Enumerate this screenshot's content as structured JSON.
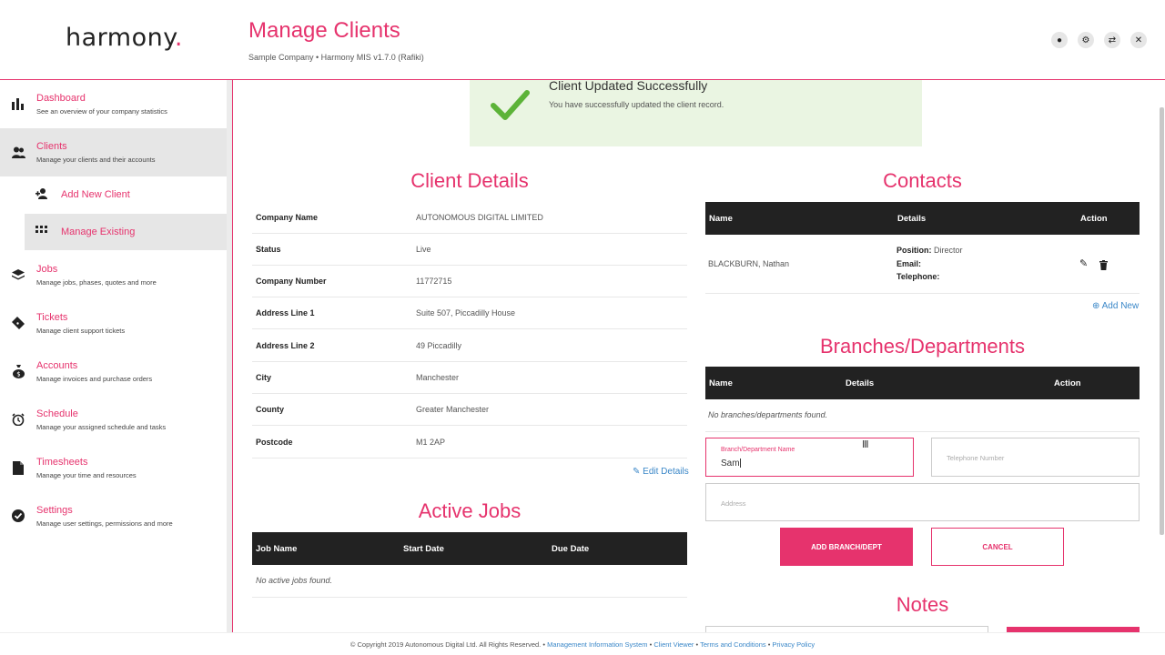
{
  "app": {
    "logo_text": "harmony",
    "logo_dot": ".",
    "title": "Manage Clients",
    "subtitle": "Sample Company • Harmony MIS v1.7.0 (Rafiki)",
    "brand_color": "#e6336d",
    "header_icons": [
      "chat-icon",
      "gear-icon",
      "swap-icon",
      "close-icon"
    ]
  },
  "sidebar": {
    "items": [
      {
        "title": "Dashboard",
        "desc": "See an overview of your company statistics",
        "icon": "bar-chart-icon"
      },
      {
        "title": "Clients",
        "desc": "Manage your clients and their accounts",
        "icon": "users-icon"
      },
      {
        "title": "Jobs",
        "desc": "Manage jobs, phases, quotes and more",
        "icon": "layers-icon"
      },
      {
        "title": "Tickets",
        "desc": "Manage client support tickets",
        "icon": "ticket-icon"
      },
      {
        "title": "Accounts",
        "desc": "Manage invoices and purchase orders",
        "icon": "money-bag-icon"
      },
      {
        "title": "Schedule",
        "desc": "Manage your assigned schedule and tasks",
        "icon": "alarm-clock-icon"
      },
      {
        "title": "Timesheets",
        "desc": "Manage your time and resources",
        "icon": "document-icon"
      },
      {
        "title": "Settings",
        "desc": "Manage user settings, permissions and more",
        "icon": "check-circle-icon"
      }
    ],
    "sub_items": [
      {
        "label": "Add New Client",
        "icon": "add-user-icon"
      },
      {
        "label": "Manage Existing",
        "icon": "grid-icon"
      }
    ]
  },
  "alert": {
    "title": "Client Updated Successfully",
    "message": "You have successfully updated the client record.",
    "color": "#eaf5e2"
  },
  "client_details": {
    "title": "Client Details",
    "rows": [
      {
        "label": "Company Name",
        "value": "AUTONOMOUS DIGITAL LIMITED"
      },
      {
        "label": "Status",
        "value": "Live"
      },
      {
        "label": "Company Number",
        "value": "11772715"
      },
      {
        "label": "Address Line 1",
        "value": "Suite 507, Piccadilly House"
      },
      {
        "label": "Address Line 2",
        "value": "49 Piccadilly"
      },
      {
        "label": "City",
        "value": "Manchester"
      },
      {
        "label": "County",
        "value": "Greater Manchester"
      },
      {
        "label": "Postcode",
        "value": "M1 2AP"
      }
    ],
    "edit_label": "Edit Details"
  },
  "active_jobs": {
    "title": "Active Jobs",
    "columns": [
      "Job Name",
      "Start Date",
      "Due Date"
    ],
    "empty": "No active jobs found."
  },
  "contacts": {
    "title": "Contacts",
    "columns": [
      "Name",
      "Details",
      "Action"
    ],
    "rows": [
      {
        "name": "BLACKBURN, Nathan",
        "position_label": "Position:",
        "position": "Director",
        "email_label": "Email:",
        "telephone_label": "Telephone:"
      }
    ],
    "add_label": "Add New"
  },
  "branches": {
    "title": "Branches/Departments",
    "columns": [
      "Name",
      "Details",
      "Action"
    ],
    "empty": "No branches/departments found.",
    "name_field": {
      "label": "Branch/Department Name",
      "value": "Sam"
    },
    "phone_placeholder": "Telephone Number",
    "address_placeholder": "Address",
    "add_button": "ADD BRANCH/DEPT",
    "cancel_button": "CANCEL"
  },
  "notes": {
    "title": "Notes"
  },
  "footer": {
    "copyright": "© Copyright 2019 Autonomous Digital Ltd. All Rights Reserved. •",
    "links": [
      "Management Information System",
      "Client Viewer",
      "Terms and Conditions",
      "Privacy Policy"
    ]
  }
}
